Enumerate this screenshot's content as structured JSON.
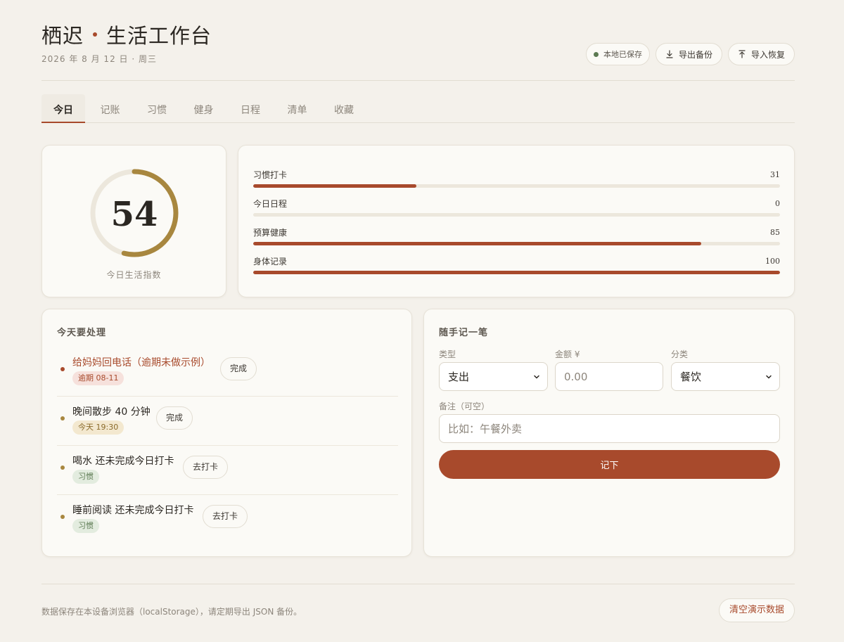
{
  "header": {
    "brand": "栖迟",
    "subtitle": "生活工作台",
    "date": "2026 年 8 月 12 日 · 周三",
    "save_status": "本地已保存",
    "export_label": "导出备份",
    "import_label": "导入恢复"
  },
  "tabs": [
    {
      "label": "今日",
      "active": true
    },
    {
      "label": "记账",
      "active": false
    },
    {
      "label": "习惯",
      "active": false
    },
    {
      "label": "健身",
      "active": false
    },
    {
      "label": "日程",
      "active": false
    },
    {
      "label": "清单",
      "active": false
    },
    {
      "label": "收藏",
      "active": false
    }
  ],
  "score": {
    "value": "54",
    "label": "今日生活指数",
    "progress": 0.54,
    "color": "#a8873f"
  },
  "metrics": [
    {
      "label": "习惯打卡",
      "value": "31",
      "percent": 31
    },
    {
      "label": "今日日程",
      "value": "0",
      "percent": 0
    },
    {
      "label": "预算健康",
      "value": "85",
      "percent": 85
    },
    {
      "label": "身体记录",
      "value": "100",
      "percent": 100
    }
  ],
  "todo": {
    "title": "今天要处理",
    "items": [
      {
        "text": "给妈妈回电话（逾期未做示例）",
        "tag": "逾期 08-11",
        "tag_style": "red",
        "action": "完成",
        "overdue": true
      },
      {
        "text": "晚间散步 40 分钟",
        "tag": "今天 19:30",
        "tag_style": "yellow",
        "action": "完成",
        "overdue": false
      },
      {
        "text": "喝水 还未完成今日打卡",
        "tag": "习惯",
        "tag_style": "green",
        "action": "去打卡",
        "overdue": false
      },
      {
        "text": "睡前阅读 还未完成今日打卡",
        "tag": "习惯",
        "tag_style": "green",
        "action": "去打卡",
        "overdue": false
      }
    ]
  },
  "quick_entry": {
    "title": "随手记一笔",
    "type_label": "类型",
    "type_value": "支出",
    "amount_label": "金额 ¥",
    "amount_placeholder": "0.00",
    "category_label": "分类",
    "category_value": "餐饮",
    "note_label": "备注（可空）",
    "note_placeholder": "比如：午餐外卖",
    "submit_label": "记下"
  },
  "footer": {
    "note": "数据保存在本设备浏览器（localStorage），请定期导出 JSON 备份。",
    "clear_label": "清空演示数据"
  },
  "colors": {
    "accent": "#a84a2c",
    "gold": "#a8873f",
    "saved_green": "#5c7a52"
  }
}
